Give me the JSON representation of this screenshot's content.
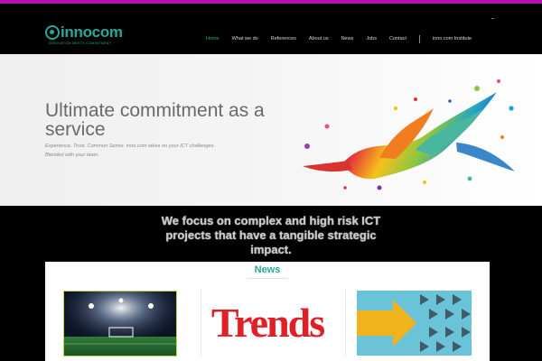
{
  "header": {
    "logo": {
      "name": "innocom",
      "tagline": "INNOVATION MEETS COMMITMENT"
    },
    "nav": [
      {
        "label": "Home",
        "active": true
      },
      {
        "label": "What we do",
        "active": false
      },
      {
        "label": "References",
        "active": false
      },
      {
        "label": "About us",
        "active": false
      },
      {
        "label": "News",
        "active": false
      },
      {
        "label": "Jobs",
        "active": false
      },
      {
        "label": "Contact",
        "active": false
      }
    ],
    "nav_extra": "inno.com Institute"
  },
  "hero": {
    "title": "Ultimate commitment as a service",
    "subtitle": "Experience. Trust. Common Sense. inno.com takes on your ICT challenges. Blended with your team."
  },
  "focus": {
    "text": "We focus on complex and high risk ICT projects that have a tangible strategic impact."
  },
  "news": {
    "heading": "News",
    "items": [
      {
        "image": "stadium-image"
      },
      {
        "image": "trends-logo",
        "logo_text": "Trends"
      },
      {
        "image": "arrows-image"
      }
    ]
  },
  "colors": {
    "accent": "#2aa79a",
    "top_border": "#b40fb4",
    "trends_red": "#e01f26",
    "arrow_yellow": "#f2b21c",
    "arrow_bg": "#6bc3d8"
  }
}
